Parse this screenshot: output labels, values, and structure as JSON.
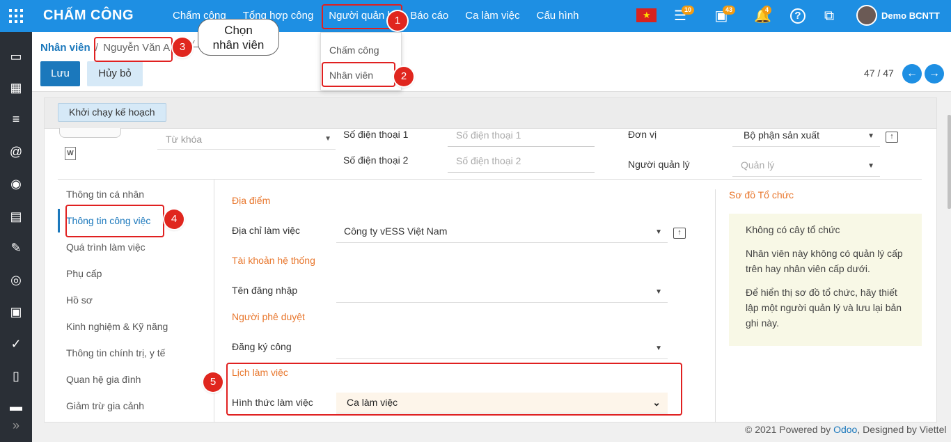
{
  "app": {
    "title": "CHẤM CÔNG"
  },
  "menu": [
    "Chấm công",
    "Tổng hợp công",
    "Người quản lý",
    "Báo cáo",
    "Ca làm việc",
    "Cấu hình"
  ],
  "dropdown": [
    "Chấm công",
    "Nhân viên"
  ],
  "topbar": {
    "badges": {
      "activities": "10",
      "calendar": "43",
      "notifications": "4"
    },
    "user": "Demo BCNTT",
    "flag_color": "#d8231f"
  },
  "breadcrumb": {
    "parent": "Nhân viên",
    "sep": "/",
    "current": "Nguyễn Văn A"
  },
  "buttons": {
    "save": "Lưu",
    "cancel": "Hủy bỏ",
    "plan": "Khởi chạy kế hoạch"
  },
  "pager": "47 / 47",
  "callout": {
    "line1": "Chọn",
    "line2": "nhân viên"
  },
  "form": {
    "keyword_placeholder": "Từ khóa",
    "phone1_label": "Số điện thoại 1",
    "phone1_placeholder": "Số điện thoại 1",
    "phone2_label": "Số điện thoại 2",
    "phone2_placeholder": "Số điện thoại 2",
    "unit_label": "Đơn vị",
    "unit_value": "Bộ phận sản xuất",
    "manager_label": "Người quản lý",
    "manager_placeholder": "Quản lý"
  },
  "tabs": [
    "Thông tin cá nhân",
    "Thông tin công việc",
    "Quá trình làm việc",
    "Phụ cấp",
    "Hồ sơ",
    "Kinh nghiệm & Kỹ năng",
    "Thông tin chính trị, y tế",
    "Quan hệ gia đình",
    "Giảm trừ gia cảnh"
  ],
  "work": {
    "location_section": "Địa điểm",
    "work_address_label": "Địa chỉ làm việc",
    "work_address_value": "Công ty vESS Việt Nam",
    "account_section": "Tài khoản hệ thống",
    "login_label": "Tên đăng nhập",
    "approver_section": "Người phê duyệt",
    "registration_label": "Đăng ký công",
    "schedule_section": "Lịch làm việc",
    "work_form_label": "Hình thức làm việc",
    "work_form_value": "Ca làm việc"
  },
  "org": {
    "title": "Sơ đồ Tổ chức",
    "p1": "Không có cây tổ chức",
    "p2": "Nhân viên này không có quản lý cấp trên hay nhân viên cấp dưới.",
    "p3": "Để hiển thị sơ đồ tổ chức, hãy thiết lập một người quản lý và lưu lại bản ghi này."
  },
  "footer": {
    "prefix": "© 2021 Powered by ",
    "odoo": "Odoo",
    "suffix": ", Designed by Viettel"
  },
  "steps": [
    "1",
    "2",
    "3",
    "4",
    "5"
  ],
  "colors": {
    "primary": "#1e8fe3",
    "accent": "#1b78bc",
    "section": "#e8762c",
    "highlight": "#e02020"
  }
}
